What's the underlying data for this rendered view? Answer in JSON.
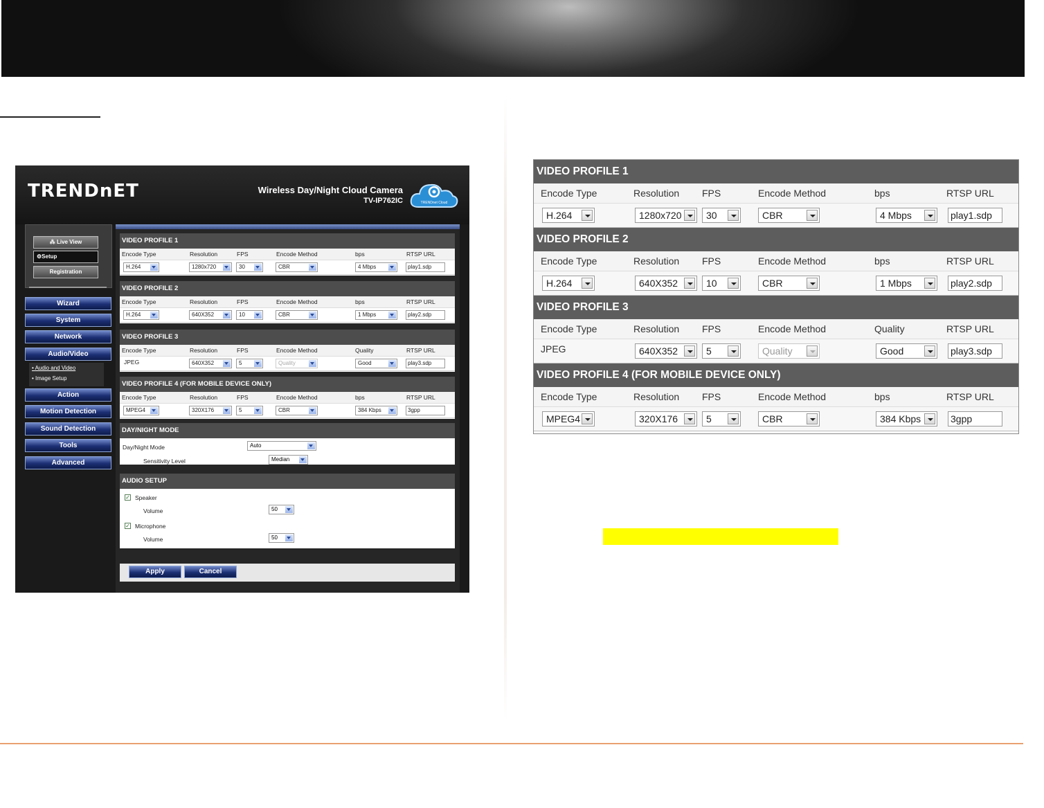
{
  "colors": {
    "highlight": "#ffff00",
    "nav_blue": "#1c2f74",
    "section_gray": "#4d4d4d",
    "footer_rule": "#e8a070"
  },
  "camera_ui": {
    "brand": "TRENDnET",
    "product_title": "Wireless Day/Night Cloud Camera",
    "product_model": "TV-IP762IC",
    "cloud_badge": "TRENDnet Cloud",
    "quick_buttons": [
      "Live View",
      "Setup",
      "Registration"
    ],
    "nav": [
      "Wizard",
      "System",
      "Network",
      "Audio/Video",
      "Action",
      "Motion Detection",
      "Sound Detection",
      "Tools",
      "Advanced"
    ],
    "sub_nav": [
      "Audio and Video",
      "Image Setup"
    ],
    "profiles": [
      {
        "title": "VIDEO PROFILE 1",
        "headers": [
          "Encode Type",
          "Resolution",
          "FPS",
          "Encode Method",
          "bps",
          "RTSP URL"
        ],
        "encode_type": "H.264",
        "resolution": "1280x720",
        "fps": "30",
        "encode_method": "CBR",
        "rate": "4 Mbps",
        "rtsp": "play1.sdp"
      },
      {
        "title": "VIDEO PROFILE 2",
        "headers": [
          "Encode Type",
          "Resolution",
          "FPS",
          "Encode Method",
          "bps",
          "RTSP URL"
        ],
        "encode_type": "H.264",
        "resolution": "640X352",
        "fps": "10",
        "encode_method": "CBR",
        "rate": "1 Mbps",
        "rtsp": "play2.sdp"
      },
      {
        "title": "VIDEO PROFILE 3",
        "headers": [
          "Encode Type",
          "Resolution",
          "FPS",
          "Encode Method",
          "Quality",
          "RTSP URL"
        ],
        "encode_type": "JPEG",
        "resolution": "640X352",
        "fps": "5",
        "encode_method": "Quality",
        "rate": "Good",
        "rtsp": "play3.sdp"
      },
      {
        "title": "VIDEO PROFILE 4 (FOR MOBILE DEVICE ONLY)",
        "headers": [
          "Encode Type",
          "Resolution",
          "FPS",
          "Encode Method",
          "bps",
          "RTSP URL"
        ],
        "encode_type": "MPEG4",
        "resolution": "320X176",
        "fps": "5",
        "encode_method": "CBR",
        "rate": "384 Kbps",
        "rtsp": "3gpp"
      }
    ],
    "day_night": {
      "title": "DAY/NIGHT MODE",
      "mode_label": "Day/Night Mode",
      "mode_value": "Auto",
      "sens_label": "Sensitivity Level",
      "sens_value": "Median"
    },
    "audio": {
      "title": "AUDIO SETUP",
      "speaker_label": "Speaker",
      "mic_label": "Microphone",
      "volume_label": "Volume",
      "speaker_volume": "50",
      "mic_volume": "50"
    },
    "apply_label": "Apply",
    "cancel_label": "Cancel"
  },
  "zoom_table": {
    "profiles": [
      {
        "title": "VIDEO PROFILE 1",
        "headers": [
          "Encode Type",
          "Resolution",
          "FPS",
          "Encode Method",
          "bps",
          "RTSP URL"
        ],
        "encode_type": "H.264",
        "resolution": "1280x720",
        "fps": "30",
        "encode_method": "CBR",
        "rate": "4 Mbps",
        "rtsp": "play1.sdp"
      },
      {
        "title": "VIDEO PROFILE 2",
        "headers": [
          "Encode Type",
          "Resolution",
          "FPS",
          "Encode Method",
          "bps",
          "RTSP URL"
        ],
        "encode_type": "H.264",
        "resolution": "640X352",
        "fps": "10",
        "encode_method": "CBR",
        "rate": "1 Mbps",
        "rtsp": "play2.sdp"
      },
      {
        "title": "VIDEO PROFILE 3",
        "headers": [
          "Encode Type",
          "Resolution",
          "FPS",
          "Encode Method",
          "Quality",
          "RTSP URL"
        ],
        "encode_type": "JPEG",
        "resolution": "640X352",
        "fps": "5",
        "encode_method": "Quality",
        "rate": "Good",
        "rtsp": "play3.sdp"
      },
      {
        "title": "VIDEO PROFILE 4 (FOR MOBILE DEVICE ONLY)",
        "headers": [
          "Encode Type",
          "Resolution",
          "FPS",
          "Encode Method",
          "bps",
          "RTSP URL"
        ],
        "encode_type": "MPEG4",
        "resolution": "320X176",
        "fps": "5",
        "encode_method": "CBR",
        "rate": "384 Kbps",
        "rtsp": "3gpp"
      }
    ]
  }
}
